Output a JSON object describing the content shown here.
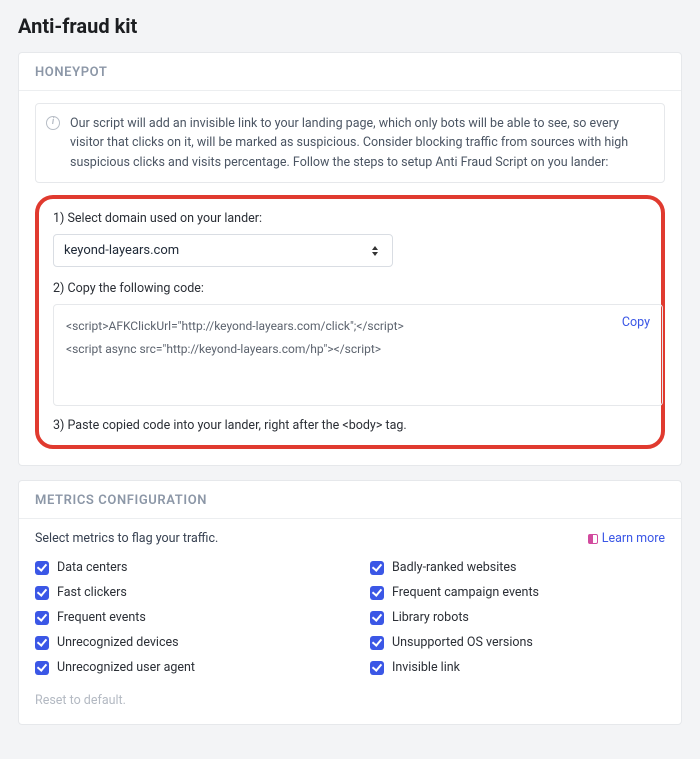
{
  "page": {
    "title": "Anti-fraud kit"
  },
  "honeypot": {
    "header": "HONEYPOT",
    "info": "Our script will add an invisible link to your landing page, which only bots will be able to see, so every visitor that clicks on it, will be marked as suspicious. Consider blocking traffic from sources with high suspicious clicks and visits percentage. Follow the steps to setup Anti Fraud Script on you lander:",
    "step1_label": "1) Select domain used on your lander:",
    "domain_selected": "keyond-layears.com",
    "step2_label": "2) Copy the following code:",
    "code_line1": "<script>AFKClickUrl=\"http://keyond-layears.com/click\";</script>",
    "code_line2": "<script async src=\"http://keyond-layears.com/hp\"></script>",
    "copy_label": "Copy",
    "step3_label": "3) Paste copied code into your lander, right after the <body> tag."
  },
  "metrics": {
    "header": "METRICS CONFIGURATION",
    "subtitle": "Select metrics to flag your traffic.",
    "learn_more": "Learn more",
    "reset": "Reset to default.",
    "left": [
      "Data centers",
      "Fast clickers",
      "Frequent events",
      "Unrecognized devices",
      "Unrecognized user agent"
    ],
    "right": [
      "Badly-ranked websites",
      "Frequent campaign events",
      "Library robots",
      "Unsupported OS versions",
      "Invisible link"
    ]
  }
}
